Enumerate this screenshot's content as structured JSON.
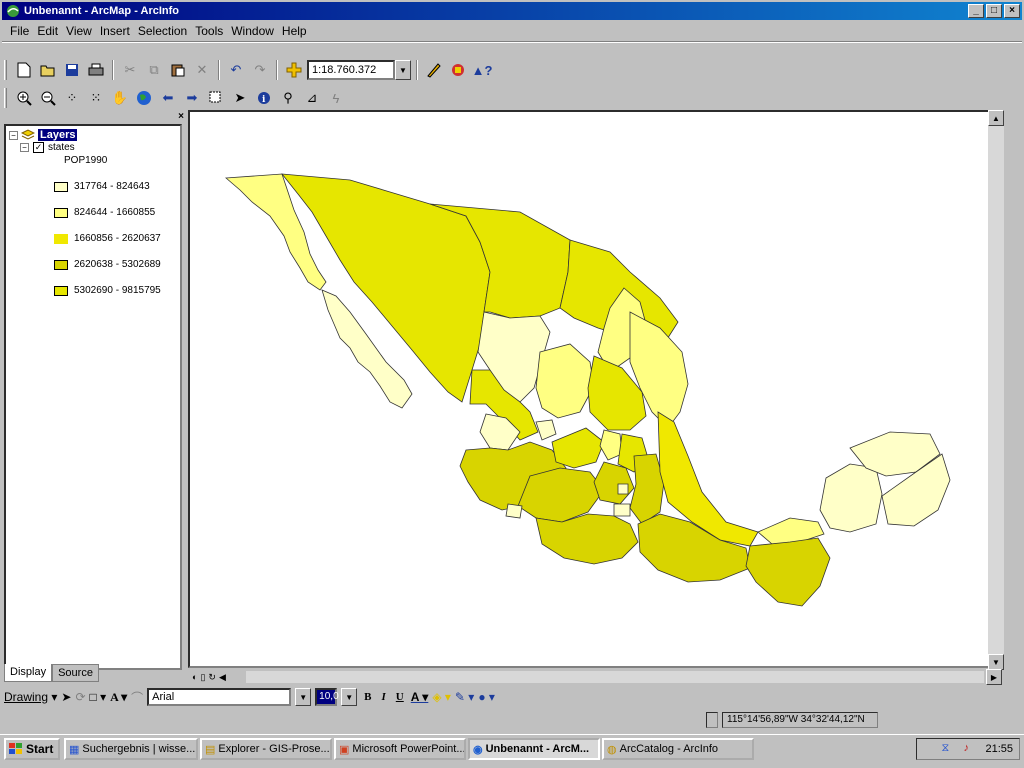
{
  "window": {
    "title": "Unbenannt - ArcMap - ArcInfo",
    "controls": [
      "_",
      "□",
      "×"
    ]
  },
  "menu": [
    "File",
    "Edit",
    "View",
    "Insert",
    "Selection",
    "Tools",
    "Window",
    "Help"
  ],
  "toolbar": {
    "scale": "1:18.760.372"
  },
  "toc": {
    "close": "×",
    "root_label": "Layers",
    "layer_label": "states",
    "field_label": "POP1990",
    "layer_checked": "✓",
    "legend": [
      {
        "label": "317764 - 824643",
        "color": "#ffffc8"
      },
      {
        "label": "824644 - 1660855",
        "color": "#ffff82"
      },
      {
        "label": "1660856 - 2620637",
        "color": "#f0e800"
      },
      {
        "label": "2620638 - 5302689",
        "color": "#d8d400"
      },
      {
        "label": "5302690 - 9815795",
        "color": "#e6e600"
      }
    ],
    "tabs": [
      "Display",
      "Source"
    ]
  },
  "map": {
    "background": "#ffffff",
    "outline_color": "#333333"
  },
  "drawing_toolbar": {
    "drawing_label": "Drawing",
    "font": "Arial",
    "size": "10,0",
    "bold": "B",
    "italic": "I",
    "underline": "U",
    "text_tool": "A"
  },
  "status": {
    "coordinates": "115°14'56,89\"W  34°32'44,12\"N"
  },
  "taskbar": {
    "start": "Start",
    "tasks": [
      "Suchergebnis | wisse...",
      "Explorer - GIS-Prose...",
      "Microsoft PowerPoint...",
      "Unbenannt - ArcM...",
      "ArcCatalog - ArcInfo"
    ],
    "clock": "21:55"
  }
}
